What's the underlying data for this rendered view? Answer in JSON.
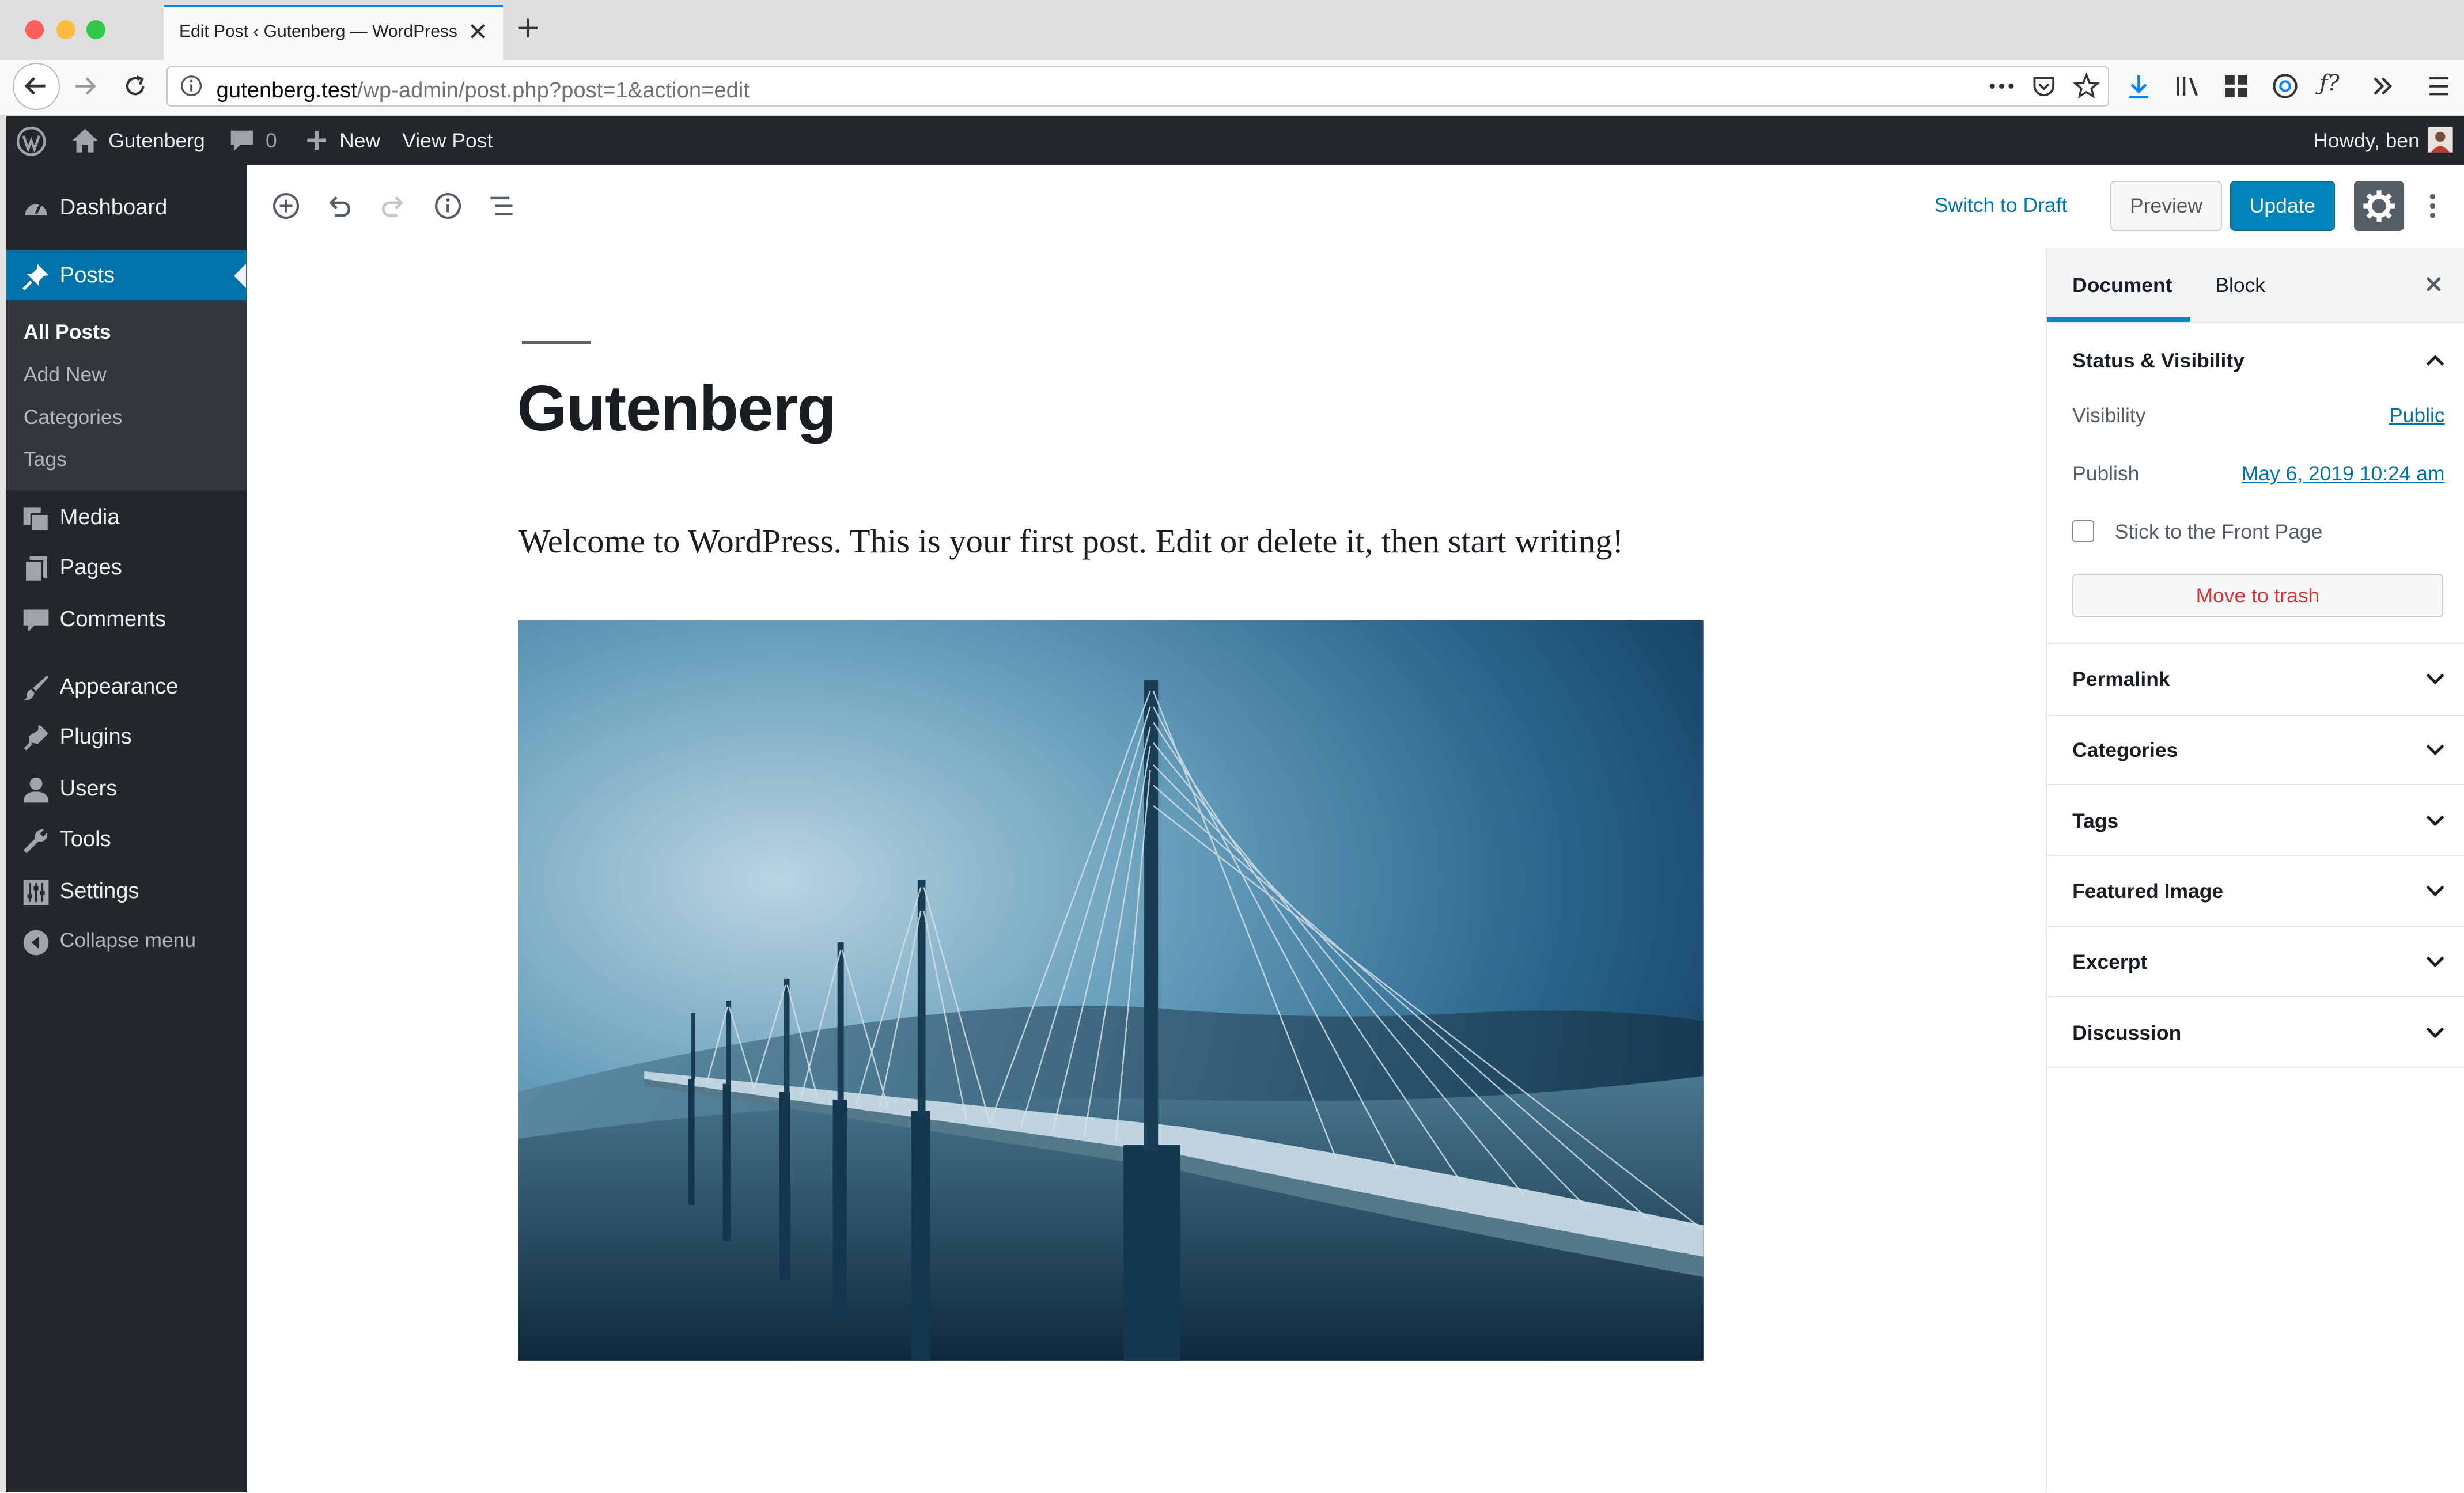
{
  "browser": {
    "tab_title": "Edit Post ‹ Gutenberg — WordPress",
    "url_host": "gutenberg.test",
    "url_path": "/wp-admin/post.php?post=1&action=edit"
  },
  "adminbar": {
    "site_name": "Gutenberg",
    "comments_count": "0",
    "new_label": "New",
    "view_post": "View Post",
    "howdy": "Howdy, ben"
  },
  "menu": {
    "dashboard": "Dashboard",
    "posts": "Posts",
    "posts_sub": [
      "All Posts",
      "Add New",
      "Categories",
      "Tags"
    ],
    "media": "Media",
    "pages": "Pages",
    "comments": "Comments",
    "appearance": "Appearance",
    "plugins": "Plugins",
    "users": "Users",
    "tools": "Tools",
    "settings": "Settings",
    "collapse": "Collapse menu"
  },
  "editor": {
    "switch_to_draft": "Switch to Draft",
    "preview": "Preview",
    "update": "Update",
    "post_title": "Gutenberg",
    "paragraph": "Welcome to WordPress. This is your first post. Edit or delete it, then start writing!"
  },
  "sidebar": {
    "tab_document": "Document",
    "tab_block": "Block",
    "status_title": "Status & Visibility",
    "visibility_label": "Visibility",
    "visibility_value": "Public",
    "publish_label": "Publish",
    "publish_value": "May 6, 2019 10:24 am",
    "sticky_label": "Stick to the Front Page",
    "trash": "Move to trash",
    "panels": [
      "Permalink",
      "Categories",
      "Tags",
      "Featured Image",
      "Excerpt",
      "Discussion"
    ]
  },
  "colors": {
    "wp_blue": "#0073aa",
    "admin_dark": "#23282d",
    "update_button": "#0085ba",
    "trash_red": "#dc3232"
  }
}
